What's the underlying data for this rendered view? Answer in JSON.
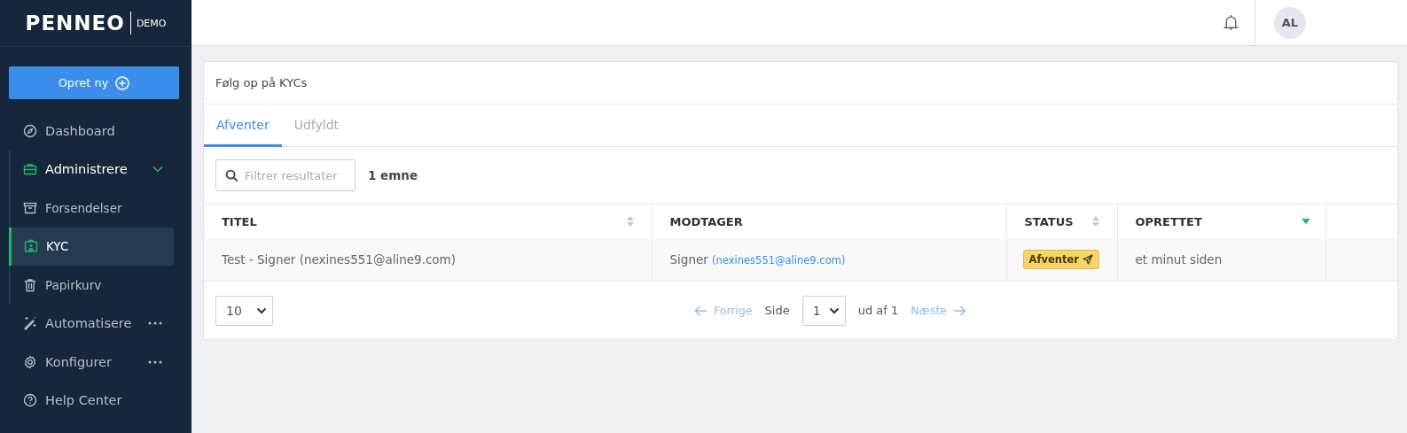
{
  "logo": {
    "brand": "PENNEO",
    "edition": "DEMO"
  },
  "sidebar": {
    "create_button": "Opret ny",
    "items": [
      {
        "label": "Dashboard",
        "selected": false
      },
      {
        "label": "Administrere",
        "selected": true,
        "expanded": true,
        "children": [
          {
            "label": "Forsendelser",
            "selected": false
          },
          {
            "label": "KYC",
            "selected": true
          },
          {
            "label": "Papirkurv",
            "selected": false
          }
        ]
      },
      {
        "label": "Automatisere",
        "selected": false,
        "more": true
      },
      {
        "label": "Konfigurer",
        "selected": false,
        "more": true
      },
      {
        "label": "Help Center",
        "selected": false
      }
    ]
  },
  "topbar": {
    "avatar": "AL"
  },
  "card": {
    "title": "Følg op på KYCs",
    "tabs": [
      {
        "label": "Afventer",
        "selected": true
      },
      {
        "label": "Udfyldt",
        "selected": false
      }
    ],
    "search": {
      "placeholder": "Filtrer resultater"
    },
    "count": "1 emne",
    "table": {
      "columns": [
        {
          "label": "TITEL",
          "sortable": true,
          "sorted": false
        },
        {
          "label": "MODTAGER",
          "sortable": false,
          "sorted": false
        },
        {
          "label": "STATUS",
          "sortable": true,
          "sorted": false
        },
        {
          "label": "OPRETTET",
          "sortable": true,
          "sorted": true
        }
      ],
      "rows": [
        {
          "title": "Test - Signer (nexines551@aline9.com)",
          "recipient": "Signer",
          "recipient_email": "(nexines551@aline9.com)",
          "status": "Afventer",
          "created": "et minut siden"
        }
      ]
    },
    "pagination": {
      "page_size": "10",
      "previous": "Forrige",
      "page_label": "Side",
      "page": "1",
      "of": "ud af 1",
      "next": "Næste"
    }
  }
}
